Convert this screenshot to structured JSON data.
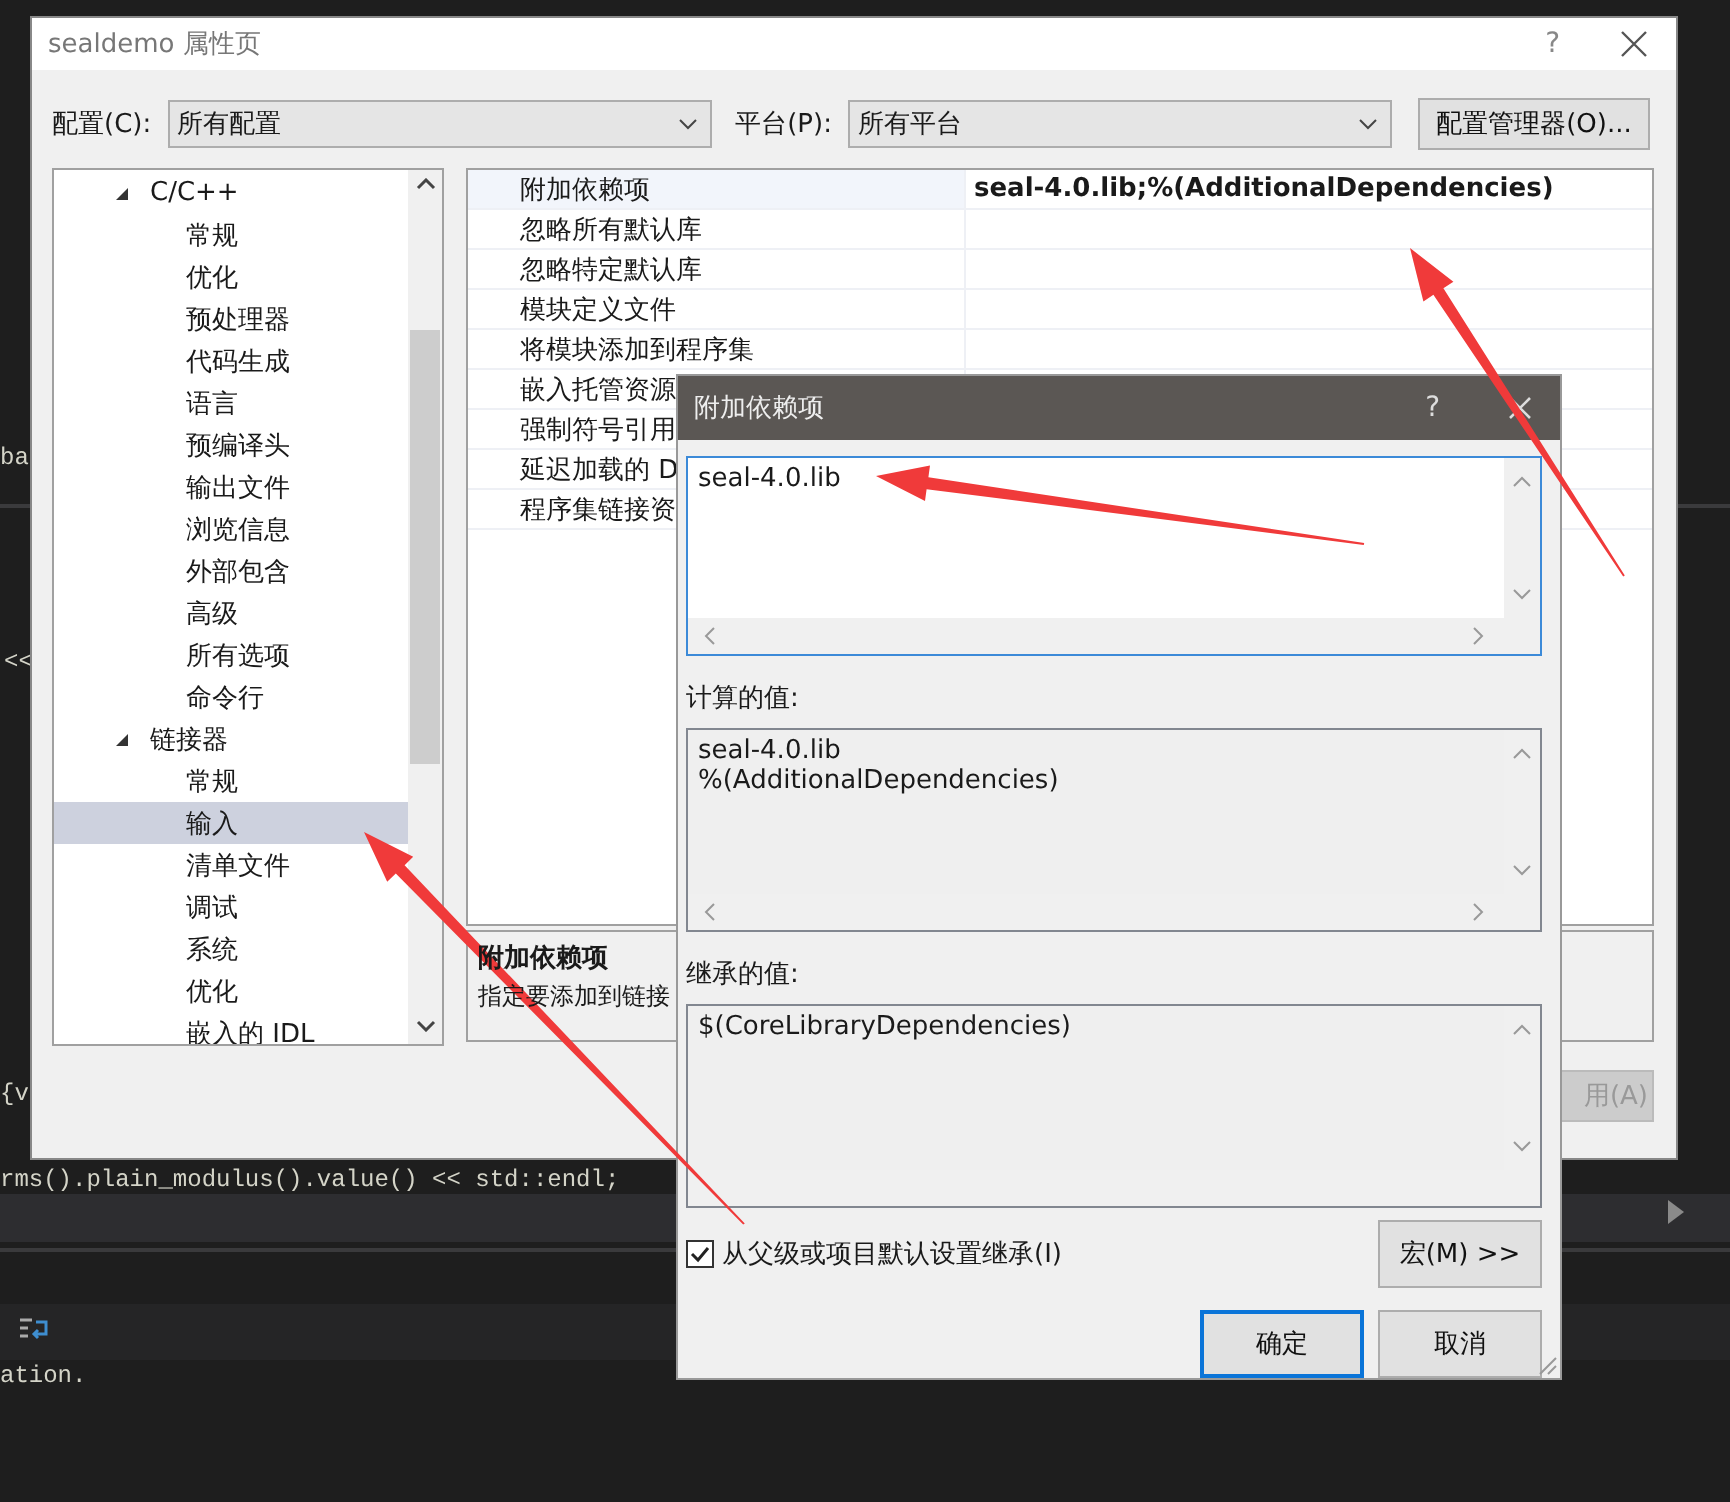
{
  "ide_background": {
    "code_fragments": [
      "ba",
      "<<",
      "{v",
      "rms().plain_modulus().value() << std::endl;",
      "ation."
    ]
  },
  "window": {
    "title": "sealdemo 属性页",
    "help": "?"
  },
  "config": {
    "label": "配置(C):",
    "value": "所有配置"
  },
  "platform": {
    "label": "平台(P):",
    "value": "所有平台"
  },
  "config_manager_button": "配置管理器(O)...",
  "tree": [
    {
      "label": "C/C++",
      "expanded": true,
      "selected": false,
      "children": [
        {
          "label": "常规",
          "selected": false
        },
        {
          "label": "优化",
          "selected": false
        },
        {
          "label": "预处理器",
          "selected": false
        },
        {
          "label": "代码生成",
          "selected": false
        },
        {
          "label": "语言",
          "selected": false
        },
        {
          "label": "预编译头",
          "selected": false
        },
        {
          "label": "输出文件",
          "selected": false
        },
        {
          "label": "浏览信息",
          "selected": false
        },
        {
          "label": "外部包含",
          "selected": false
        },
        {
          "label": "高级",
          "selected": false
        },
        {
          "label": "所有选项",
          "selected": false
        },
        {
          "label": "命令行",
          "selected": false
        }
      ]
    },
    {
      "label": "链接器",
      "expanded": true,
      "selected": false,
      "children": [
        {
          "label": "常规",
          "selected": false
        },
        {
          "label": "输入",
          "selected": true
        },
        {
          "label": "清单文件",
          "selected": false
        },
        {
          "label": "调试",
          "selected": false
        },
        {
          "label": "系统",
          "selected": false
        },
        {
          "label": "优化",
          "selected": false
        },
        {
          "label": "嵌入的 IDL",
          "selected": false
        }
      ]
    }
  ],
  "properties": [
    {
      "name": "附加依赖项",
      "value": "seal-4.0.lib;%(AdditionalDependencies)",
      "selected": true
    },
    {
      "name": "忽略所有默认库",
      "selected": false
    },
    {
      "name": "忽略特定默认库",
      "selected": false
    },
    {
      "name": "模块定义文件",
      "selected": false
    },
    {
      "name": "将模块添加到程序集",
      "selected": false
    },
    {
      "name": "嵌入托管资源",
      "selected": false
    },
    {
      "name": "强制符号引用",
      "selected": false
    },
    {
      "name": "延迟加载的 D",
      "selected": false
    },
    {
      "name": "程序集链接资",
      "selected": false
    }
  ],
  "description": {
    "title": "附加依赖项",
    "text": "指定要添加到链接"
  },
  "apply_button": {
    "label": "用(A)",
    "disabled": true
  },
  "dialog": {
    "title": "附加依赖项",
    "help": "?",
    "value": "seal-4.0.lib",
    "computed_label": "计算的值:",
    "computed_lines": [
      "seal-4.0.lib",
      "%(AdditionalDependencies)"
    ],
    "inherited_label": "继承的值:",
    "inherited_lines": [
      "$(CoreLibraryDependencies)"
    ],
    "inherit_checkbox": {
      "label": "从父级或项目默认设置继承(I)",
      "checked": true
    },
    "macros_button": "宏(M) >>",
    "ok_button": "确定",
    "cancel_button": "取消"
  }
}
